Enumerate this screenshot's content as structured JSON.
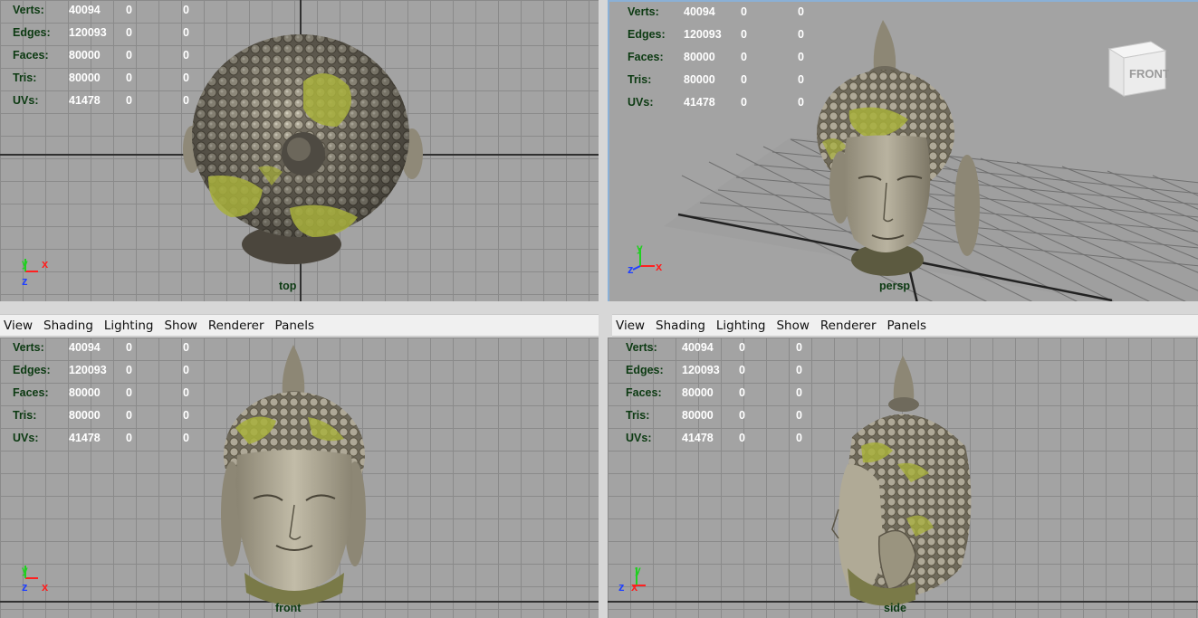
{
  "hud": {
    "labels": {
      "verts": "Verts:",
      "edges": "Edges:",
      "faces": "Faces:",
      "tris": "Tris:",
      "uvs": "UVs:"
    },
    "values": {
      "verts": [
        "40094",
        "0",
        "0"
      ],
      "edges": [
        "120093",
        "0",
        "0"
      ],
      "faces": [
        "80000",
        "0",
        "0"
      ],
      "tris": [
        "80000",
        "0",
        "0"
      ],
      "uvs": [
        "41478",
        "0",
        "0"
      ]
    }
  },
  "viewports": {
    "top": {
      "camera": "top"
    },
    "persp": {
      "camera": "persp",
      "view_cube_label": "FRONT"
    },
    "front": {
      "camera": "front"
    },
    "side": {
      "camera": "side"
    }
  },
  "menubar": [
    "View",
    "Shading",
    "Lighting",
    "Show",
    "Renderer",
    "Panels"
  ],
  "axes": {
    "x": "x",
    "y": "y",
    "z": "z"
  },
  "colors": {
    "viewport_bg": "#a3a3a3",
    "grid": "#8a8a8a",
    "hud_label": "#0c3a12",
    "hud_value": "#ffffff",
    "axis_x": "#ff2020",
    "axis_y": "#20d020",
    "axis_z": "#2040ff",
    "stone": "#9b9584",
    "moss": "#9aa638"
  },
  "model_icons": [
    "buddha-head-top-icon",
    "buddha-head-persp-icon",
    "buddha-head-front-icon",
    "buddha-head-side-icon"
  ]
}
